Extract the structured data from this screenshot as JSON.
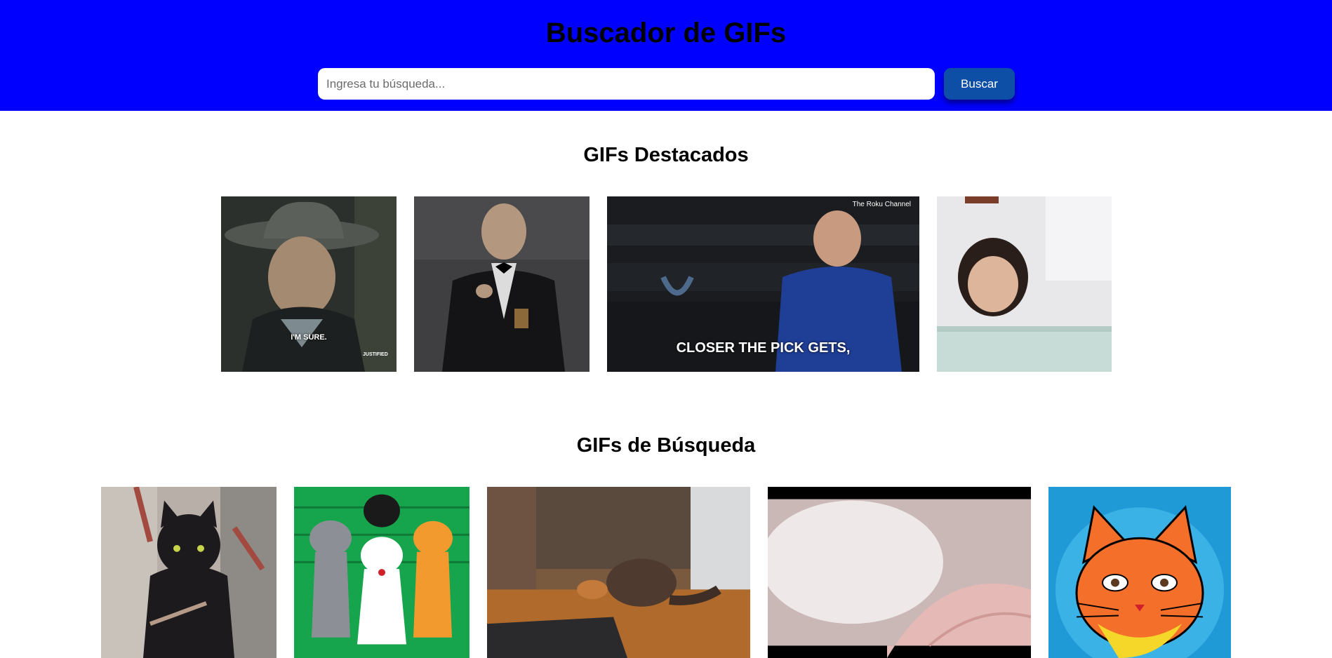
{
  "header": {
    "title": "Buscador de GIFs",
    "search": {
      "placeholder": "Ingresa tu búsqueda...",
      "value": ""
    },
    "search_button_label": "Buscar",
    "background_color": "#0000ff",
    "button_color": "#0d4ea6"
  },
  "featured": {
    "title": "GIFs Destacados",
    "gifs": [
      {
        "subject": "man in cowboy hat",
        "caption": "I'M SURE.",
        "watermark": "JUSTIFIED"
      },
      {
        "subject": "man in tuxedo holding glass",
        "caption": "",
        "watermark": ""
      },
      {
        "subject": "man in blue sweater in stadium seats",
        "caption": "CLOSER THE PICK GETS,",
        "watermark": "The Roku Channel"
      },
      {
        "subject": "toddler eating snack",
        "caption": "",
        "watermark": ""
      }
    ]
  },
  "search_results": {
    "title": "GIFs de Búsqueda",
    "gifs": [
      {
        "subject": "black cat pixelated"
      },
      {
        "subject": "cartoon cats dancing"
      },
      {
        "subject": "cat and kitten playing on floor"
      },
      {
        "subject": "white cat close-up"
      },
      {
        "subject": "orange cartoon cat face"
      }
    ]
  }
}
